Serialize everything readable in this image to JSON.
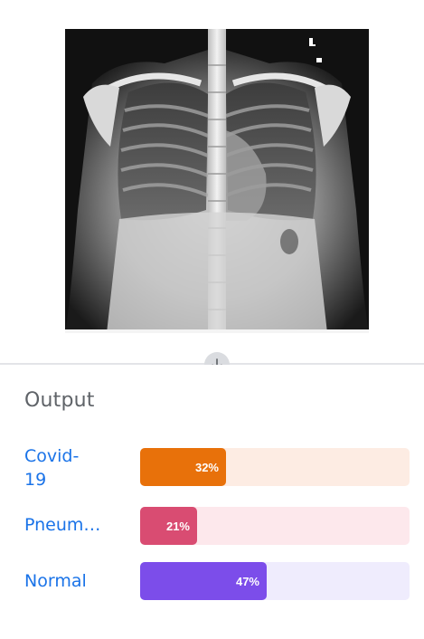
{
  "output": {
    "title": "Output",
    "results": [
      {
        "label": "Covid-19",
        "percent_label": "32%",
        "fraction": 0.32,
        "fill_color": "#e8710a",
        "track_color": "#fdece3"
      },
      {
        "label": "Pneumonia",
        "percent_label": "21%",
        "fraction": 0.21,
        "fill_color": "#d94c72",
        "track_color": "#fde8ec"
      },
      {
        "label": "Normal",
        "percent_label": "47%",
        "fraction": 0.47,
        "fill_color": "#7c4dea",
        "track_color": "#efecfd"
      }
    ]
  },
  "icons": {
    "arrow": "arrow-down-icon"
  },
  "colors": {
    "divider": "#e3e4e8",
    "label": "#1a73e8",
    "title": "#5f6368"
  }
}
